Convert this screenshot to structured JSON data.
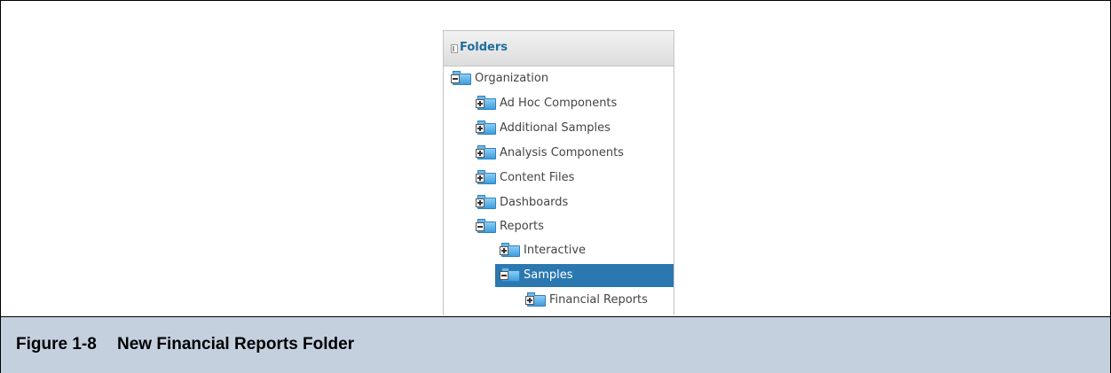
{
  "panel": {
    "title": "Folders",
    "collapse_icon": "panel-collapse-icon"
  },
  "tree": [
    {
      "label": "Organization",
      "state": "expanded",
      "selected": false
    },
    {
      "label": "Ad Hoc Components",
      "state": "collapsed",
      "selected": false
    },
    {
      "label": "Additional Samples",
      "state": "collapsed",
      "selected": false
    },
    {
      "label": "Analysis Components",
      "state": "collapsed",
      "selected": false
    },
    {
      "label": "Content Files",
      "state": "collapsed",
      "selected": false
    },
    {
      "label": "Dashboards",
      "state": "collapsed",
      "selected": false
    },
    {
      "label": "Reports",
      "state": "expanded",
      "selected": false
    },
    {
      "label": "Interactive",
      "state": "collapsed",
      "selected": false
    },
    {
      "label": "Samples",
      "state": "expanded",
      "selected": true
    },
    {
      "label": "Financial Reports",
      "state": "collapsed",
      "selected": false
    }
  ],
  "caption": {
    "number": "Figure 1-8",
    "title": "New Financial Reports Folder"
  },
  "colors": {
    "selection": "#2b78b0",
    "panel_title": "#1d6e9e",
    "caption_background": "#c5d0df"
  }
}
